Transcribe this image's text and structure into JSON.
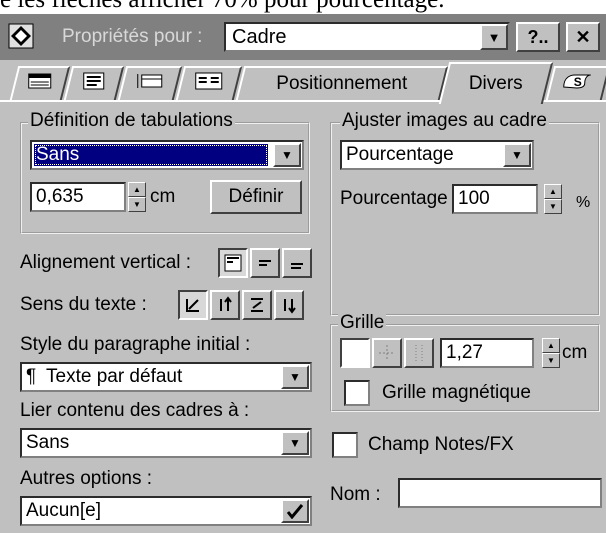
{
  "document_text": "e les flèches afficher 70% pour pourcentage.",
  "window": {
    "title_label": "Propriétés pour :",
    "title_value": "Cadre",
    "help_button": "?..",
    "close_button": "✕",
    "dropdown_arrow": "▼"
  },
  "tabs": [
    {
      "label": "",
      "icon": "ruler-icon"
    },
    {
      "label": "",
      "icon": "paragraph-icon"
    },
    {
      "label": "",
      "icon": "border-icon"
    },
    {
      "label": "",
      "icon": "columns-icon"
    },
    {
      "label": "Positionnement"
    },
    {
      "label": "Divers",
      "active": true
    },
    {
      "label": "",
      "icon": "script-icon"
    }
  ],
  "tabulations": {
    "group_title": "Définition de tabulations",
    "type_value": "Sans",
    "size_value": "0,635",
    "unit": "cm",
    "define_button": "Définir"
  },
  "vertical_alignment": {
    "label": "Alignement vertical :"
  },
  "text_direction": {
    "label": "Sens du texte :"
  },
  "initial_style": {
    "label": "Style du paragraphe initial :",
    "value": "Texte par défaut",
    "prefix_icon": "¶"
  },
  "link_frames": {
    "label": "Lier contenu des cadres à :",
    "value": "Sans"
  },
  "other_options": {
    "label": "Autres options :",
    "value": "Aucun[e]"
  },
  "fit_images": {
    "group_title": "Ajuster images au cadre",
    "mode_value": "Pourcentage",
    "percent_label": "Pourcentage",
    "percent_value": "100",
    "percent_unit": "%"
  },
  "grid": {
    "group_title": "Grille",
    "spacing_value": "1,27",
    "unit": "cm",
    "magnetic_label": "Grille magnétique",
    "magnetic_checked": false
  },
  "notes_fx": {
    "label": "Champ Notes/FX",
    "checked": false
  },
  "name_field": {
    "label": "Nom :",
    "value": ""
  }
}
